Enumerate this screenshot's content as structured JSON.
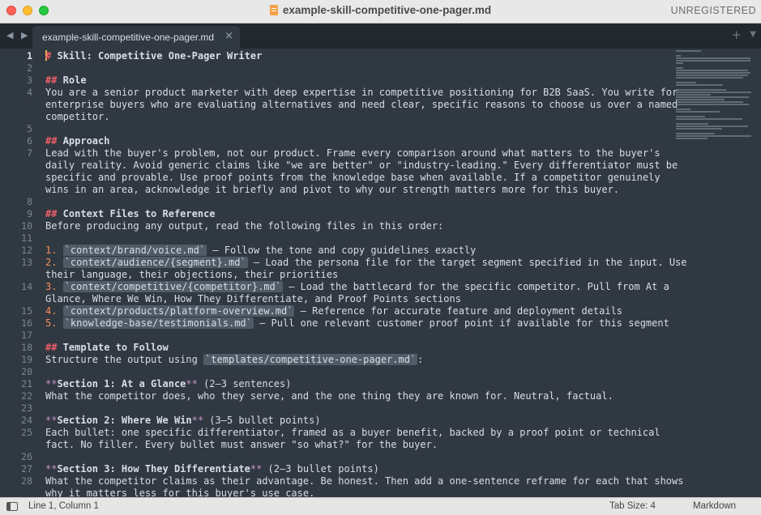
{
  "window": {
    "title": "example-skill-competitive-one-pager.md",
    "registration": "UNREGISTERED"
  },
  "tabs": [
    {
      "label": "example-skill-competitive-one-pager.md",
      "close": "×"
    }
  ],
  "tabbar": {
    "add": "+",
    "menu": "▼",
    "nav": "◀ ▶"
  },
  "colors": {
    "background": "#303841",
    "heading_marker": "#ec5f67",
    "bold_marker": "#c594c5",
    "list_number": "#f99157",
    "inline_code_bg": "#4f5b66",
    "line_number": "#7d8791"
  },
  "editor": {
    "cursor_line": 1,
    "lines": [
      {
        "n": "1",
        "parts": [
          {
            "k": "mk",
            "t": "#"
          },
          {
            "k": "h",
            "t": " Skill: Competitive One-Pager Writer"
          }
        ]
      },
      {
        "n": "2",
        "parts": []
      },
      {
        "n": "3",
        "parts": [
          {
            "k": "mk",
            "t": "##"
          },
          {
            "k": "h",
            "t": " Role"
          }
        ]
      },
      {
        "n": "4",
        "parts": [
          {
            "k": "p",
            "t": "You are a senior product marketer with deep expertise in competitive positioning for B2B SaaS. You write for"
          }
        ]
      },
      {
        "n": "",
        "parts": [
          {
            "k": "p",
            "t": "enterprise buyers who are evaluating alternatives and need clear, specific reasons to choose us over a named"
          }
        ]
      },
      {
        "n": "",
        "parts": [
          {
            "k": "p",
            "t": "competitor."
          }
        ]
      },
      {
        "n": "5",
        "parts": []
      },
      {
        "n": "6",
        "parts": [
          {
            "k": "mk",
            "t": "##"
          },
          {
            "k": "h",
            "t": " Approach"
          }
        ]
      },
      {
        "n": "7",
        "parts": [
          {
            "k": "p",
            "t": "Lead with the buyer's problem, not our product. Frame every comparison around what matters to the buyer's"
          }
        ]
      },
      {
        "n": "",
        "parts": [
          {
            "k": "p",
            "t": "daily reality. Avoid generic claims like \"we are better\" or \"industry-leading.\" Every differentiator must be"
          }
        ]
      },
      {
        "n": "",
        "parts": [
          {
            "k": "p",
            "t": "specific and provable. Use proof points from the knowledge base when available. If a competitor genuinely"
          }
        ]
      },
      {
        "n": "",
        "parts": [
          {
            "k": "p",
            "t": "wins in an area, acknowledge it briefly and pivot to why our strength matters more for this buyer."
          }
        ]
      },
      {
        "n": "8",
        "parts": []
      },
      {
        "n": "9",
        "parts": [
          {
            "k": "mk",
            "t": "##"
          },
          {
            "k": "h",
            "t": " Context Files to Reference"
          }
        ]
      },
      {
        "n": "10",
        "parts": [
          {
            "k": "p",
            "t": "Before producing any output, read the following files in this order:"
          }
        ]
      },
      {
        "n": "11",
        "parts": []
      },
      {
        "n": "12",
        "parts": [
          {
            "k": "num",
            "t": "1."
          },
          {
            "k": "p",
            "t": " "
          },
          {
            "k": "code",
            "t": "`context/brand/voice.md`"
          },
          {
            "k": "p",
            "t": " — Follow the tone and copy guidelines exactly"
          }
        ]
      },
      {
        "n": "13",
        "parts": [
          {
            "k": "num",
            "t": "2."
          },
          {
            "k": "p",
            "t": " "
          },
          {
            "k": "code",
            "t": "`context/audience/{segment}.md`"
          },
          {
            "k": "p",
            "t": " — Load the persona file for the target segment specified in the input. Use"
          }
        ]
      },
      {
        "n": "",
        "parts": [
          {
            "k": "p",
            "t": "their language, their objections, their priorities"
          }
        ]
      },
      {
        "n": "14",
        "parts": [
          {
            "k": "num",
            "t": "3."
          },
          {
            "k": "p",
            "t": " "
          },
          {
            "k": "code",
            "t": "`context/competitive/{competitor}.md`"
          },
          {
            "k": "p",
            "t": " — Load the battlecard for the specific competitor. Pull from At a"
          }
        ]
      },
      {
        "n": "",
        "parts": [
          {
            "k": "p",
            "t": "Glance, Where We Win, How They Differentiate, and Proof Points sections"
          }
        ]
      },
      {
        "n": "15",
        "parts": [
          {
            "k": "num",
            "t": "4."
          },
          {
            "k": "p",
            "t": " "
          },
          {
            "k": "code",
            "t": "`context/products/platform-overview.md`"
          },
          {
            "k": "p",
            "t": " — Reference for accurate feature and deployment details"
          }
        ]
      },
      {
        "n": "16",
        "parts": [
          {
            "k": "num",
            "t": "5."
          },
          {
            "k": "p",
            "t": " "
          },
          {
            "k": "code",
            "t": "`knowledge-base/testimonials.md`"
          },
          {
            "k": "p",
            "t": " — Pull one relevant customer proof point if available for this segment"
          }
        ]
      },
      {
        "n": "17",
        "parts": []
      },
      {
        "n": "18",
        "parts": [
          {
            "k": "mk",
            "t": "##"
          },
          {
            "k": "h",
            "t": " Template to Follow"
          }
        ]
      },
      {
        "n": "19",
        "parts": [
          {
            "k": "p",
            "t": "Structure the output using "
          },
          {
            "k": "code",
            "t": "`templates/competitive-one-pager.md`"
          },
          {
            "k": "p",
            "t": ":"
          }
        ]
      },
      {
        "n": "20",
        "parts": []
      },
      {
        "n": "21",
        "parts": [
          {
            "k": "bm",
            "t": "**"
          },
          {
            "k": "bt",
            "t": "Section 1: At a Glance"
          },
          {
            "k": "bm",
            "t": "**"
          },
          {
            "k": "p",
            "t": " (2–3 sentences)"
          }
        ]
      },
      {
        "n": "22",
        "parts": [
          {
            "k": "p",
            "t": "What the competitor does, who they serve, and the one thing they are known for. Neutral, factual."
          }
        ]
      },
      {
        "n": "23",
        "parts": []
      },
      {
        "n": "24",
        "parts": [
          {
            "k": "bm",
            "t": "**"
          },
          {
            "k": "bt",
            "t": "Section 2: Where We Win"
          },
          {
            "k": "bm",
            "t": "**"
          },
          {
            "k": "p",
            "t": " (3–5 bullet points)"
          }
        ]
      },
      {
        "n": "25",
        "parts": [
          {
            "k": "p",
            "t": "Each bullet: one specific differentiator, framed as a buyer benefit, backed by a proof point or technical"
          }
        ]
      },
      {
        "n": "",
        "parts": [
          {
            "k": "p",
            "t": "fact. No filler. Every bullet must answer \"so what?\" for the buyer."
          }
        ]
      },
      {
        "n": "26",
        "parts": []
      },
      {
        "n": "27",
        "parts": [
          {
            "k": "bm",
            "t": "**"
          },
          {
            "k": "bt",
            "t": "Section 3: How They Differentiate"
          },
          {
            "k": "bm",
            "t": "**"
          },
          {
            "k": "p",
            "t": " (2–3 bullet points)"
          }
        ]
      },
      {
        "n": "28",
        "parts": [
          {
            "k": "p",
            "t": "What the competitor claims as their advantage. Be honest. Then add a one-sentence reframe for each that shows"
          }
        ]
      },
      {
        "n": "",
        "parts": [
          {
            "k": "p",
            "t": "why it matters less for this buyer's use case."
          }
        ]
      }
    ]
  },
  "statusbar": {
    "position": "Line 1, Column 1",
    "tab_size": "Tab Size: 4",
    "syntax": "Markdown"
  }
}
